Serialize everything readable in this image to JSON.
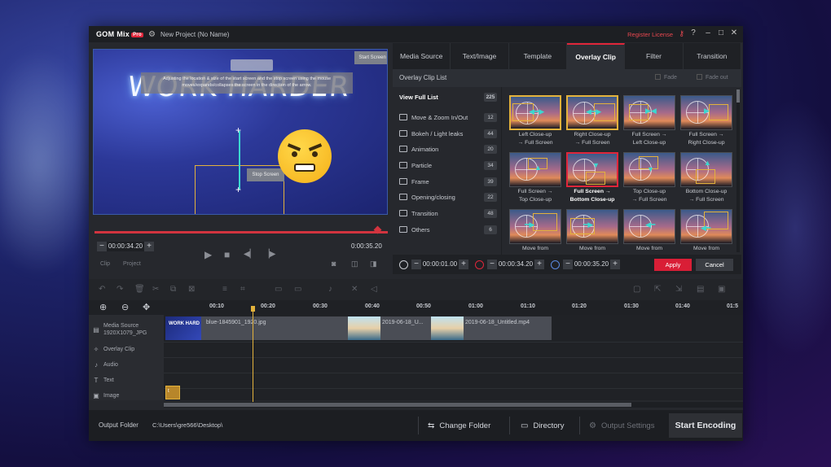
{
  "titlebar": {
    "logo": "GOM Mix",
    "logo_badge": "Pro",
    "project": "New Project (No Name)",
    "register": "Register License",
    "help": "?",
    "minimize": "–",
    "maximize": "□",
    "close": "✕"
  },
  "preview": {
    "neon_text": "WORK HARDER",
    "start_screen": "Start Screen",
    "tooltip": "Adjusting the location & size of the start screen and the stop screen using the mouse moves/expands/collapses the screen in the direction of the arrow.",
    "stop_screen": "Stop Screen",
    "current_time": "00:00:34.20",
    "duration": "0:00:35.20",
    "clip_tab": "Clip",
    "project_tab": "Project"
  },
  "tabs": [
    "Media Source",
    "Text/Image",
    "Template",
    "Overlay Clip",
    "Filter",
    "Transition"
  ],
  "active_tab": "Overlay Clip",
  "cliplist": {
    "title": "Overlay Clip List",
    "fade1": "Fade",
    "fade2": "Fade out"
  },
  "categories": [
    {
      "label": "View Full List",
      "count": "225"
    },
    {
      "label": "Move & Zoom In/Out",
      "count": "12"
    },
    {
      "label": "Bokeh / Light leaks",
      "count": "44"
    },
    {
      "label": "Animation",
      "count": "20"
    },
    {
      "label": "Particle",
      "count": "34"
    },
    {
      "label": "Frame",
      "count": "39"
    },
    {
      "label": "Opening/closing",
      "count": "22"
    },
    {
      "label": "Transition",
      "count": "48"
    },
    {
      "label": "Others",
      "count": "6"
    }
  ],
  "thumbnails": [
    {
      "l1": "Left Close-up",
      "l2": "→ Full Screen"
    },
    {
      "l1": "Right Close-up",
      "l2": "→ Full Screen"
    },
    {
      "l1": "Full Screen →",
      "l2": "Left Close-up"
    },
    {
      "l1": "Full Screen →",
      "l2": "Right Close-up"
    },
    {
      "l1": "Full Screen →",
      "l2": "Top Close-up"
    },
    {
      "l1": "Full Screen →",
      "l2": "Bottom Close-up"
    },
    {
      "l1": "Top Close-up",
      "l2": "→ Full Screen"
    },
    {
      "l1": "Bottom Close-up",
      "l2": "→ Full Screen"
    },
    {
      "l1": "Move from",
      "l2": ""
    },
    {
      "l1": "Move from",
      "l2": ""
    },
    {
      "l1": "Move from",
      "l2": ""
    },
    {
      "l1": "Move from",
      "l2": ""
    }
  ],
  "overlay_times": {
    "start": "00:00:01.00",
    "mid": "00:00:34.20",
    "end": "00:00:35.20",
    "apply": "Apply",
    "cancel": "Cancel"
  },
  "ruler": [
    "00:10",
    "00:20",
    "00:30",
    "00:40",
    "00:50",
    "01:00",
    "01:10",
    "01:20",
    "01:30",
    "01:40",
    "01:5"
  ],
  "tracks": {
    "media_source": "Media Source",
    "media_res": "1920X1079_JPG",
    "overlay": "Overlay Clip",
    "audio": "Audio",
    "text": "Text",
    "image": "Image"
  },
  "clips": {
    "thumb_text": "WORK HARD",
    "main": "blue-1845901_1920.jpg",
    "video1": "2019-06-18_U...",
    "video2": "2019-06-18_Untitled.mp4",
    "image_clip": "t"
  },
  "footer": {
    "output_label": "Output Folder",
    "output_path": "C:\\Users\\gre566\\Desktop\\",
    "change_folder": "Change Folder",
    "directory": "Directory",
    "output_settings": "Output Settings",
    "start_encoding": "Start Encoding"
  }
}
